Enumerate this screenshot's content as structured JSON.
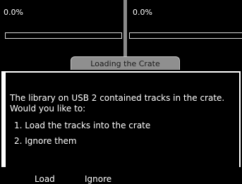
{
  "decks": [
    {
      "progress_text": "0.0%",
      "progress": 0.0
    },
    {
      "progress_text": "0.0%",
      "progress": 0.0
    }
  ],
  "dialog": {
    "title": "Loading the Crate",
    "message": "The library on USB 2 contained tracks in the crate. Would you like to:",
    "options": [
      "1. Load the tracks into the crate",
      "2. Ignore them"
    ]
  },
  "softkeys": {
    "load_label": "Load",
    "ignore_label": "Ignore"
  },
  "colors": {
    "background": "#000000",
    "tab": "#8f8f8f",
    "dialog_border": "#ffffff",
    "text": "#ffffff"
  }
}
